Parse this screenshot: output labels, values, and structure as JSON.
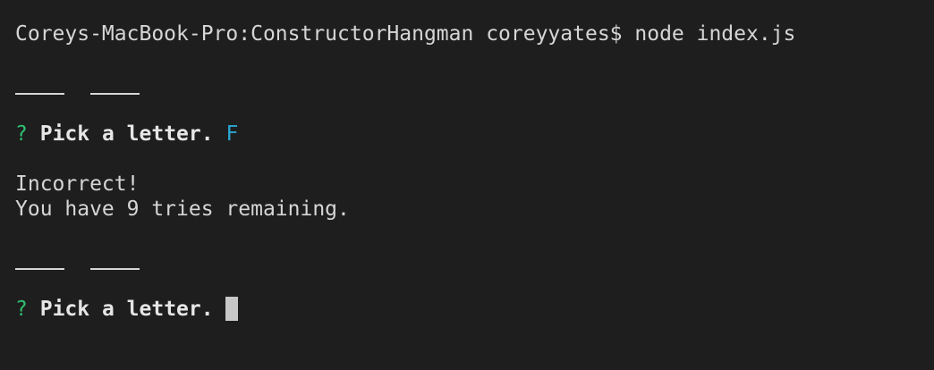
{
  "terminal": {
    "prompt": "Coreys-MacBook-Pro:ConstructorHangman coreyyates$",
    "command": "node index.js",
    "question_mark": "?",
    "question_text": "Pick a letter.",
    "first_answer": "F",
    "incorrect_message": "Incorrect!",
    "tries_message": "You have 9 tries remaining.",
    "colors": {
      "background": "#1e1e1e",
      "text": "#d6d6d6",
      "question_mark": "#2fbf71",
      "answer": "#2aa7d6",
      "cursor": "#c8c8c8"
    }
  }
}
